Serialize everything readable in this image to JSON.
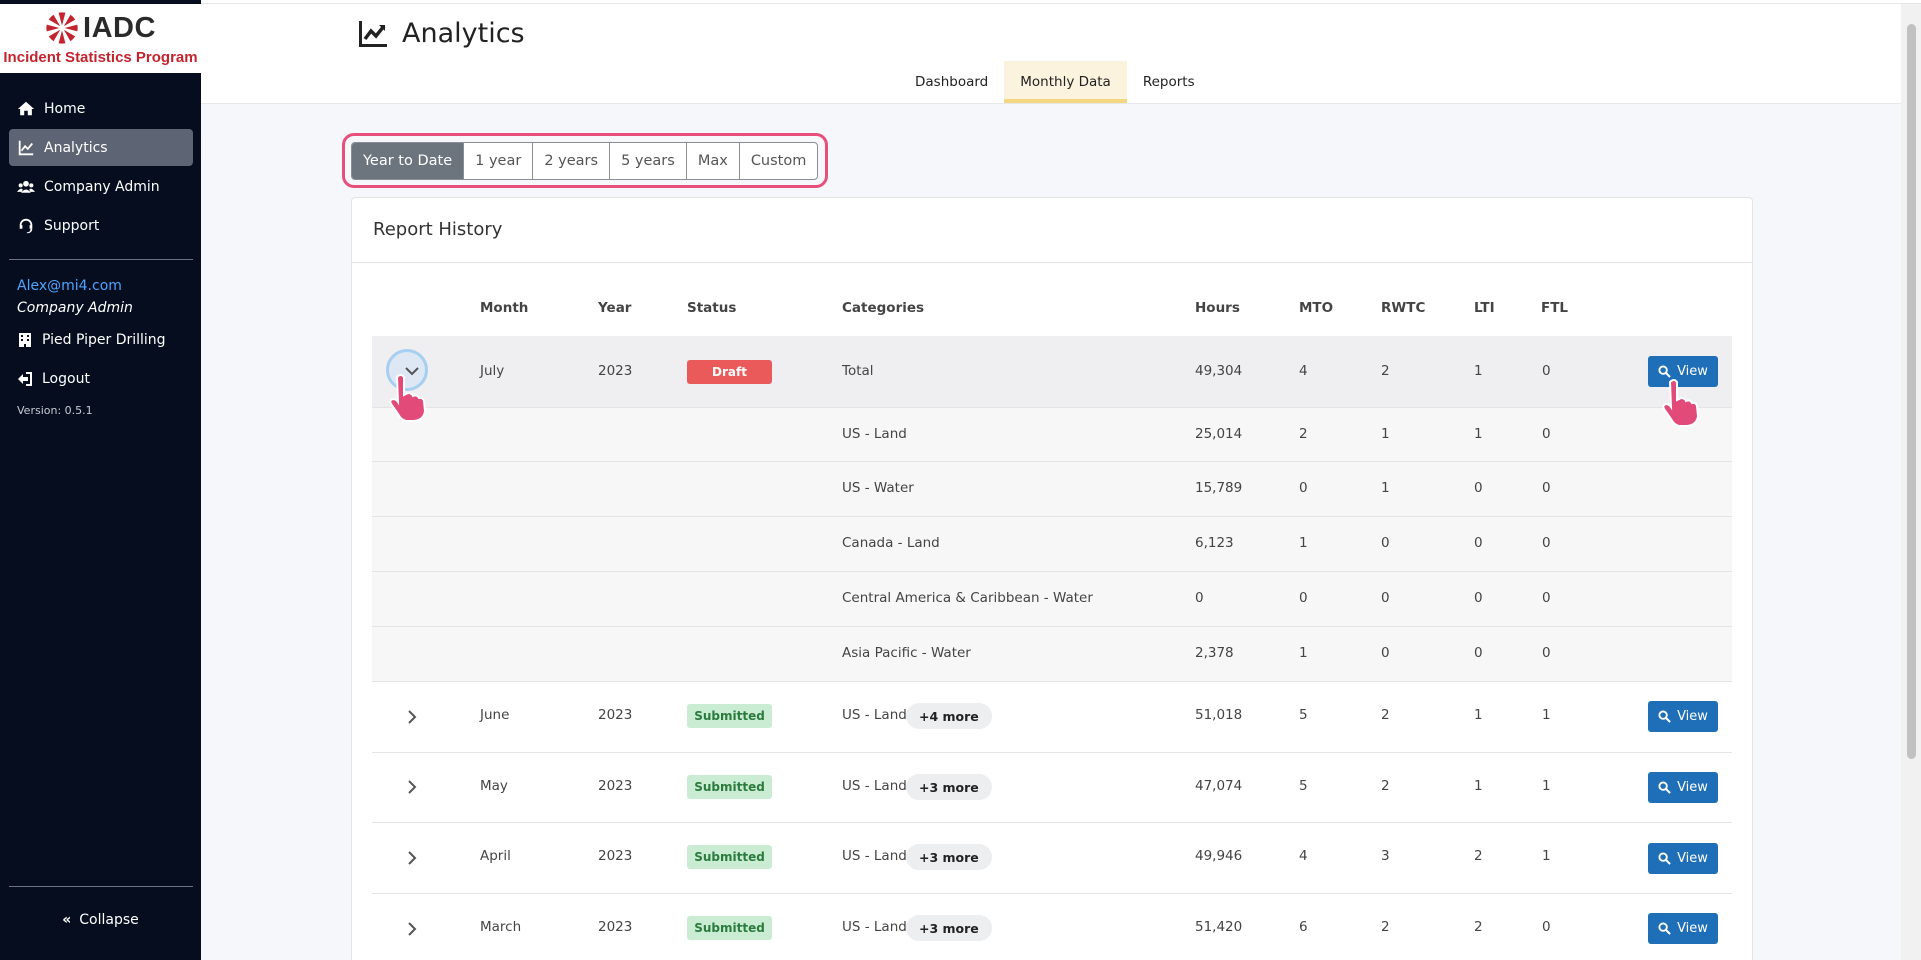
{
  "sidebar": {
    "logo_text": "IADC",
    "logo_subtitle": "Incident Statistics Program",
    "nav": [
      {
        "label": "Home",
        "icon": "home-icon"
      },
      {
        "label": "Analytics",
        "icon": "chart-line-icon",
        "active": true
      },
      {
        "label": "Company Admin",
        "icon": "users-icon"
      },
      {
        "label": "Support",
        "icon": "headset-icon"
      }
    ],
    "user_email": "Alex@mi4.com",
    "user_role": "Company Admin",
    "company": "Pied Piper Drilling",
    "logout": "Logout",
    "version": "Version: 0.5.1",
    "collapse": "Collapse"
  },
  "header": {
    "title": "Analytics",
    "tabs": [
      {
        "label": "Dashboard"
      },
      {
        "label": "Monthly Data",
        "active": true
      },
      {
        "label": "Reports"
      }
    ]
  },
  "period": {
    "options": [
      "Year to Date",
      "1 year",
      "2 years",
      "5 years",
      "Max",
      "Custom"
    ],
    "selected": "Year to Date"
  },
  "report": {
    "title": "Report History",
    "columns": [
      "Month",
      "Year",
      "Status",
      "Categories",
      "Hours",
      "MTO",
      "RWTC",
      "LTI",
      "FTL"
    ],
    "view_label": "View",
    "expanded": {
      "month": "July",
      "year": "2023",
      "status": "Draft",
      "category": "Total",
      "hours": "49,304",
      "mto": "4",
      "rwtc": "2",
      "lti": "1",
      "ftl": "0",
      "sub_rows": [
        {
          "category": "US - Land",
          "hours": "25,014",
          "mto": "2",
          "rwtc": "1",
          "lti": "1",
          "ftl": "0"
        },
        {
          "category": "US - Water",
          "hours": "15,789",
          "mto": "0",
          "rwtc": "1",
          "lti": "0",
          "ftl": "0"
        },
        {
          "category": "Canada - Land",
          "hours": "6,123",
          "mto": "1",
          "rwtc": "0",
          "lti": "0",
          "ftl": "0"
        },
        {
          "category": "Central America & Caribbean - Water",
          "hours": "0",
          "mto": "0",
          "rwtc": "0",
          "lti": "0",
          "ftl": "0"
        },
        {
          "category": "Asia Pacific - Water",
          "hours": "2,378",
          "mto": "1",
          "rwtc": "0",
          "lti": "0",
          "ftl": "0"
        }
      ]
    },
    "rows": [
      {
        "month": "June",
        "year": "2023",
        "status": "Submitted",
        "category": "US - Land",
        "more": "+4 more",
        "hours": "51,018",
        "mto": "5",
        "rwtc": "2",
        "lti": "1",
        "ftl": "1"
      },
      {
        "month": "May",
        "year": "2023",
        "status": "Submitted",
        "category": "US - Land",
        "more": "+3 more",
        "hours": "47,074",
        "mto": "5",
        "rwtc": "2",
        "lti": "1",
        "ftl": "1"
      },
      {
        "month": "April",
        "year": "2023",
        "status": "Submitted",
        "category": "US - Land",
        "more": "+3 more",
        "hours": "49,946",
        "mto": "4",
        "rwtc": "3",
        "lti": "2",
        "ftl": "1"
      },
      {
        "month": "March",
        "year": "2023",
        "status": "Submitted",
        "category": "US - Land",
        "more": "+3 more",
        "hours": "51,420",
        "mto": "6",
        "rwtc": "2",
        "lti": "2",
        "ftl": "0"
      }
    ]
  },
  "colors": {
    "sidebar_bg": "#050d1f",
    "active_nav": "#5d6473",
    "draft": "#eb5a5a",
    "submitted_bg": "#c9ecd2",
    "view_button": "#1f6fb8",
    "highlight": "#e8507c"
  }
}
